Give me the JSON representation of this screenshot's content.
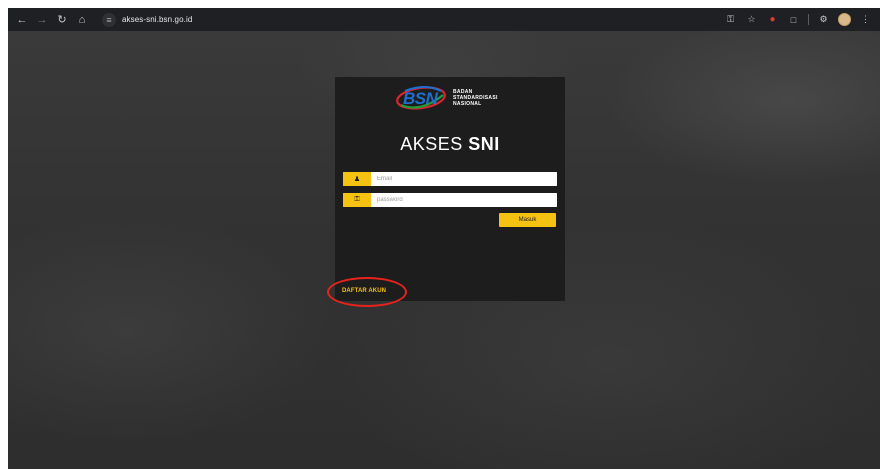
{
  "browser": {
    "url": "akses-sni.bsn.go.id",
    "icons": {
      "back": "arrow-left-icon",
      "forward": "arrow-right-icon",
      "reload": "reload-icon",
      "home": "home-icon",
      "site_info": "site-settings-icon",
      "password": "key-icon",
      "bookmark": "star-icon",
      "extension_red": "extension-icon",
      "extensions": "puzzle-icon",
      "profile": "avatar-icon"
    }
  },
  "logo": {
    "mark": "BSN",
    "sub_lines": [
      "BADAN",
      "STANDARDISASI",
      "NASIONAL"
    ]
  },
  "login": {
    "title_light": "AKSES",
    "title_bold": "SNI",
    "email_placeholder": "Email",
    "password_placeholder": "password",
    "submit_label": "Masuk",
    "register_link": "DAFTAR AKUN"
  },
  "colors": {
    "accent": "#f5c211",
    "panel": "#1d1d1d",
    "highlight": "#e8231c"
  }
}
